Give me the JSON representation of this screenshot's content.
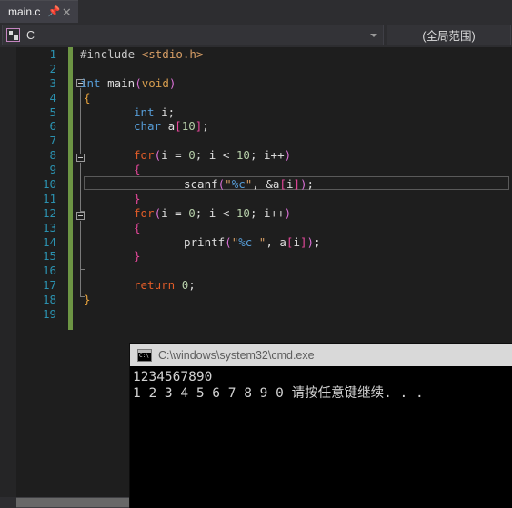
{
  "tab": {
    "label": "main.c",
    "pin_icon": "pin-icon",
    "close_icon": "close-icon"
  },
  "navbar": {
    "language_icon": "c-language-icon",
    "scope_left": "C",
    "scope_right": "(全局范围)",
    "dropdown_icon": "chevron-down-icon"
  },
  "editor": {
    "line_numbers": [
      "1",
      "2",
      "3",
      "4",
      "5",
      "6",
      "7",
      "8",
      "9",
      "10",
      "11",
      "12",
      "13",
      "14",
      "15",
      "16",
      "17",
      "18",
      "19"
    ],
    "lines": [
      "#include <stdio.h>",
      "",
      "int main(void)",
      "{",
      "    int i;",
      "    char a[10];",
      "",
      "    for(i = 0; i < 10; i++)",
      "    {",
      "        scanf(\"%c\", &a[i]);",
      "    }",
      "    for(i = 0; i < 10; i++)",
      "    {",
      "        printf(\"%c \", a[i]);",
      "    }",
      "",
      "    return 0;",
      "}",
      ""
    ],
    "colors": {
      "background": "#1e1e1e",
      "line_number": "#2b91af",
      "keyword": "#569cd6",
      "control_keyword": "#e05c28",
      "string": "#d69d65",
      "number": "#b5cea8",
      "change_bar": "#6d9544"
    }
  },
  "console": {
    "title": "C:\\windows\\system32\\cmd.exe",
    "icon": "cmd-icon",
    "lines": [
      "1234567890",
      "1 2 3 4 5 6 7 8 9 0 请按任意键继续. . ."
    ]
  }
}
